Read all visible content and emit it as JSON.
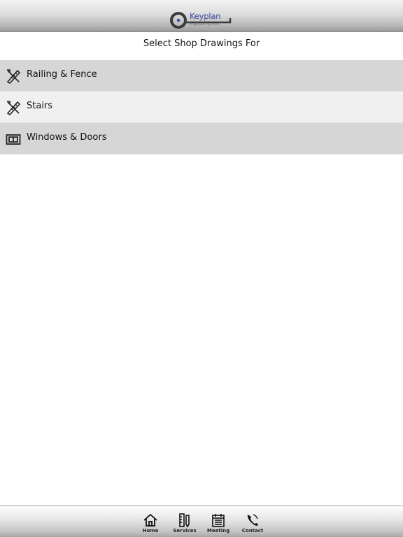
{
  "header": {
    "logo_text": "Keyplan",
    "logo_subtext": "Engineering.com"
  },
  "page": {
    "subtitle": "Select Shop Drawings For"
  },
  "menu": {
    "items": [
      {
        "label": "Railing & Fence",
        "icon": "drafting-tools-icon"
      },
      {
        "label": "Stairs",
        "icon": "drafting-tools-icon"
      },
      {
        "label": "Windows & Doors",
        "icon": "window-frame-icon"
      }
    ]
  },
  "tabbar": {
    "items": [
      {
        "label": "Home",
        "icon": "home-icon"
      },
      {
        "label": "Services",
        "icon": "services-icon"
      },
      {
        "label": "Meeting",
        "icon": "calendar-icon"
      },
      {
        "label": "Contact",
        "icon": "phone-icon"
      }
    ]
  }
}
